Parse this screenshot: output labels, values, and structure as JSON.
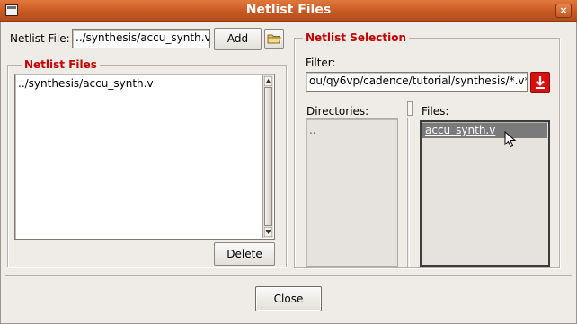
{
  "window": {
    "title": "Netlist Files",
    "close_glyph": "×"
  },
  "top": {
    "netlist_file_label": "Netlist File:",
    "netlist_file_value": "../synthesis/accu_synth.v",
    "add_label": "Add",
    "browse_icon": "folder-icon"
  },
  "netlist_files": {
    "title": "Netlist Files",
    "items": [
      "../synthesis/accu_synth.v"
    ],
    "delete_label": "Delete"
  },
  "netlist_selection": {
    "title": "Netlist Selection",
    "filter_label": "Filter:",
    "filter_value": "ou/qy6vp/cadence/tutorial/synthesis/*.v*",
    "filter_button_icon": "download-arrow-icon",
    "directories_label": "Directories:",
    "directories": [
      ".."
    ],
    "files_label": "Files:",
    "files": [
      "accu_synth.v"
    ],
    "selected_file": "accu_synth.v"
  },
  "footer": {
    "close_label": "Close"
  },
  "colors": {
    "titlebar": "#c85a24",
    "group_title": "#c00000",
    "filter_button": "#d9100e",
    "selected_row": "#7a7a7a"
  }
}
